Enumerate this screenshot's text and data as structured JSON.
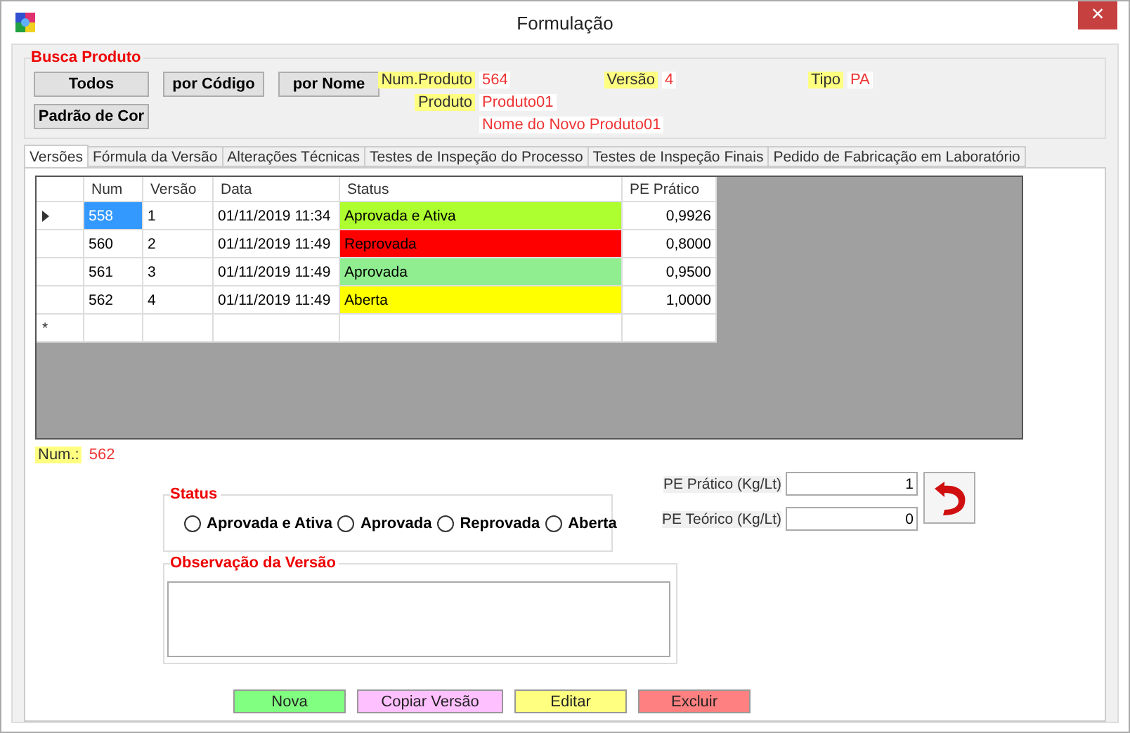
{
  "window": {
    "title": "Formulação",
    "close": "×"
  },
  "search": {
    "title": "Busca Produto",
    "buttons": [
      "Todos",
      "por Código",
      "por Nome",
      "Padrão de Cor"
    ],
    "info_rows": [
      [
        {
          "label": "Num.Produto",
          "value": "564"
        },
        {
          "label": "Versão",
          "value": "4"
        },
        {
          "label": "Tipo",
          "value": "PA"
        }
      ],
      [
        {
          "label": "Produto",
          "value": "Produto01"
        }
      ],
      [
        {
          "value": "Nome do Novo Produto01"
        }
      ]
    ]
  },
  "tabs": [
    {
      "label": "Versões",
      "selected": true
    },
    {
      "label": "Fórmula da Versão",
      "selected": false
    },
    {
      "label": "Alterações Técnicas",
      "selected": false
    },
    {
      "label": "Testes de Inspeção do Processo",
      "selected": false
    },
    {
      "label": "Testes de Inspeção Finais",
      "selected": false
    },
    {
      "label": "Pedido de Fabricação em Laboratório",
      "selected": false
    }
  ],
  "table": {
    "columns": [
      "Num",
      "Versão",
      "Data",
      "Status",
      "PE Prático"
    ],
    "rows": [
      {
        "selected": true,
        "num": "558",
        "versao": "1",
        "data": "01/11/2019 11:34",
        "status": "Aprovada e Ativa",
        "color": "#adff2f",
        "pe": "0,9926"
      },
      {
        "selected": false,
        "num": "560",
        "versao": "2",
        "data": "01/11/2019 11:49",
        "status": "Reprovada",
        "color": "#ff0000",
        "pe": "0,8000"
      },
      {
        "selected": false,
        "num": "561",
        "versao": "3",
        "data": "01/11/2019 11:49",
        "status": "Aprovada",
        "color": "#90ee90",
        "pe": "0,9500"
      },
      {
        "selected": false,
        "num": "562",
        "versao": "4",
        "data": "01/11/2019 11:49",
        "status": "Aberta",
        "color": "#ffff00",
        "pe": "1,0000"
      }
    ],
    "new_row_marker": "*"
  },
  "num_field": {
    "label": "Num.:",
    "value": "562"
  },
  "status_group": {
    "title": "Status",
    "options": [
      {
        "label": "Aprovada e Ativa",
        "selected": false
      },
      {
        "label": "Aprovada",
        "selected": false
      },
      {
        "label": "Reprovada",
        "selected": false
      },
      {
        "label": "Aberta",
        "selected": false
      }
    ]
  },
  "pe_fields": [
    {
      "label": "PE Prático (Kg/Lt)",
      "value": "1"
    },
    {
      "label": "PE Teórico (Kg/Lt)",
      "value": "0"
    }
  ],
  "observation": {
    "title": "Observação da Versão"
  },
  "actions": [
    {
      "label": "Nova",
      "color": "#80ff80"
    },
    {
      "label": "Copiar Versão",
      "color": "#ffc0ff"
    },
    {
      "label": "Editar",
      "color": "#ffff80"
    },
    {
      "label": "Excluir",
      "color": "#ff8080"
    }
  ]
}
